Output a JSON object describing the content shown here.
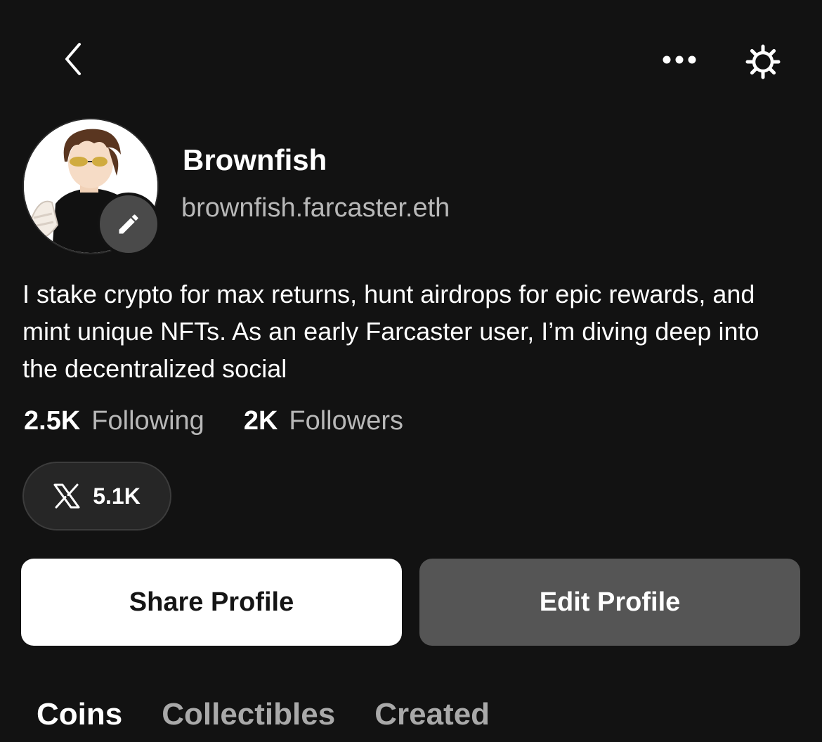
{
  "header": {
    "back_icon": "chevron-left-icon",
    "more_icon": "more-horizontal-icon",
    "settings_icon": "gear-icon"
  },
  "profile": {
    "display_name": "Brownfish",
    "username": "brownfish.farcaster.eth",
    "bio": "I stake crypto for max returns, hunt airdrops for epic rewards, and mint unique NFTs. As an early Farcaster user, I’m diving deep into the decentralized social",
    "avatar_edit_icon": "pencil-icon"
  },
  "stats": {
    "following_count": "2.5K",
    "following_label": "Following",
    "followers_count": "2K",
    "followers_label": "Followers"
  },
  "social": {
    "x_icon": "x-logo-icon",
    "x_count": "5.1K"
  },
  "actions": {
    "share_label": "Share Profile",
    "edit_label": "Edit Profile"
  },
  "tabs": [
    {
      "label": "Coins",
      "active": true
    },
    {
      "label": "Collectibles",
      "active": false
    },
    {
      "label": "Created",
      "active": false
    }
  ],
  "colors": {
    "background": "#121212",
    "secondary_text": "#b8b8b8",
    "edit_button_bg": "#555555",
    "share_button_bg": "#ffffff"
  }
}
